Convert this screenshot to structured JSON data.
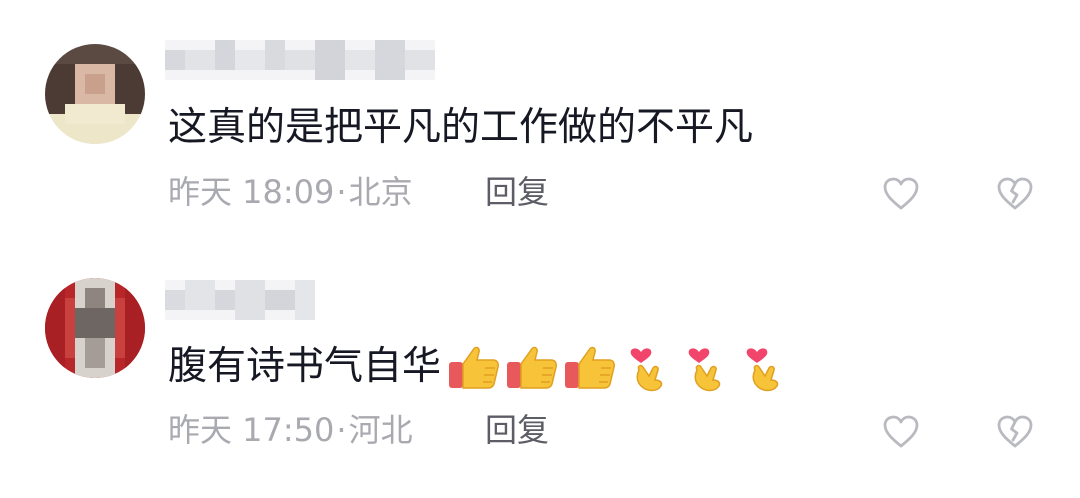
{
  "comments": [
    {
      "username": "",
      "text": "这真的是把平凡的工作做的不平凡",
      "time": "昨天 18:09",
      "location": "北京",
      "reply_label": "回复"
    },
    {
      "username": "",
      "text": "腹有诗书气自华",
      "emojis": [
        "thumbs-up-icon",
        "thumbs-up-icon",
        "thumbs-up-icon",
        "finger-heart-icon",
        "finger-heart-icon",
        "finger-heart-icon"
      ],
      "time": "昨天 17:50",
      "location": "河北",
      "reply_label": "回复"
    }
  ],
  "meta_separator": "·",
  "colors": {
    "text": "#161823",
    "meta": "#a9aab0",
    "reply": "#5c5d66",
    "icon": "#b9bac0"
  }
}
